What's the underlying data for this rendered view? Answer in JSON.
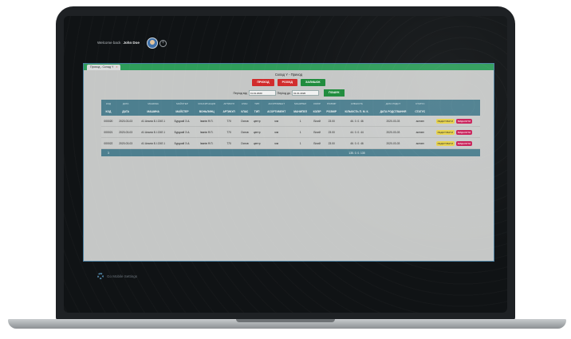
{
  "header": {
    "welcome_prefix": "Welcome back",
    "user_name": "John Doe",
    "add_symbol": "+"
  },
  "tab": {
    "label": "Приход - Склад Y",
    "close": "×"
  },
  "page_title": "Склад Y - Приход",
  "toolbar": {
    "btn1": "ПРИХОД",
    "btn2": "РОЗХІД",
    "btn3": "ЗАЛИШОК"
  },
  "period": {
    "from_label": "Період від",
    "from_value": "01.01.2020",
    "to_label": "Період до",
    "to_value": "01.01.2020",
    "search": "ПОШУК"
  },
  "table": {
    "filters": [
      "КОД",
      "ДАТА",
      "МАШИНА",
      "МАЙСТЕР",
      "КОНСИГНАЦІЯ",
      "АРТИКУЛ",
      "КЛАС",
      "ТИП",
      "АСОРТИМЕНТ",
      "МАНИПЕЛ",
      "КОЛІР",
      "РОЗМІР",
      "КІЛЬКІСТЬ",
      "ДАТА РОДСТ",
      "СТАТУС"
    ],
    "columns": [
      "КОД",
      "ДАТА",
      "МАШИНА",
      "МАЙСТЕР",
      "ВОНЬЛИНЦ",
      "АРТИКУЛ",
      "КЛАС",
      "ТИП",
      "АСОРТИМЕНТ",
      "МАНИПЕЛ",
      "КОЛІР",
      "РОЗМІР",
      "КІЛЬКІСТЬ П. М. К.",
      "ДАТА РОДСТВАННЯ",
      "СТАТУС"
    ],
    "rows": [
      {
        "code": "000020",
        "date": "2020-03-03",
        "machine": "#1 Аналіз Б.І.СКЛ.1",
        "master": "Бурдзий З.А.",
        "vol": "Іванів Ф.П.",
        "article": "770",
        "class": "Основ",
        "type": "центр",
        "assortment": "мм",
        "manipel": "1",
        "color": "Білий",
        "size": "23.00",
        "qty": "46. 0. 0. 46",
        "date_prod": "2020-03-03",
        "status": "активн"
      },
      {
        "code": "000021",
        "date": "2020-03-03",
        "machine": "#1 Аналіз Б.І.СКЛ.1",
        "master": "Бурдзий З.А.",
        "vol": "Іванів Ф.П.",
        "article": "770",
        "class": "Основ",
        "type": "центр",
        "assortment": "мм",
        "manipel": "1",
        "color": "Білий",
        "size": "23.00",
        "qty": "44. 0. 0. 44",
        "date_prod": "2020-03-03",
        "status": "активн"
      },
      {
        "code": "000022",
        "date": "2020-03-03",
        "machine": "#1 Аналіз Б.І.СКЛ.1",
        "master": "Бурдзий З.А.",
        "vol": "Іванів Ф.П.",
        "article": "770",
        "class": "Основ",
        "type": "центр",
        "assortment": "мм",
        "manipel": "1",
        "color": "Білий",
        "size": "23.00",
        "qty": "46. 0. 0. 46",
        "date_prod": "2020-03-03",
        "status": "активн"
      }
    ],
    "edit_label": "РЕДАГУВАТИ",
    "delete_label": "ВИДАЛИТИ",
    "footer": {
      "count": "3",
      "total": "135. 0. 0. 135"
    }
  },
  "footer_settings": {
    "label": "Go Mobile Settings"
  }
}
